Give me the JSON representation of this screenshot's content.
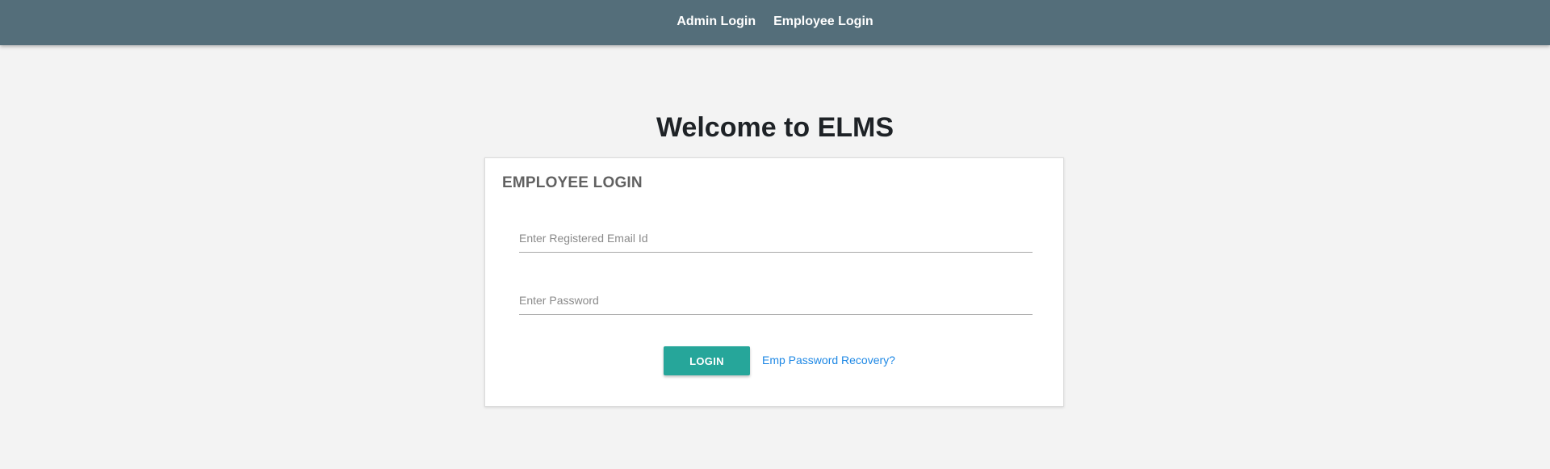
{
  "nav": {
    "admin_login": "Admin Login",
    "employee_login": "Employee Login"
  },
  "page": {
    "title": "Welcome to ELMS"
  },
  "card": {
    "title": "EMPLOYEE LOGIN",
    "email_placeholder": "Enter Registered Email Id",
    "email_value": "",
    "password_placeholder": "Enter Password",
    "password_value": "",
    "login_label": "LOGIN",
    "recovery_label": "Emp Password Recovery?"
  },
  "colors": {
    "topbar": "#546e7a",
    "background": "#f3f3f3",
    "button": "#26a69a",
    "link": "#1e88e5"
  }
}
